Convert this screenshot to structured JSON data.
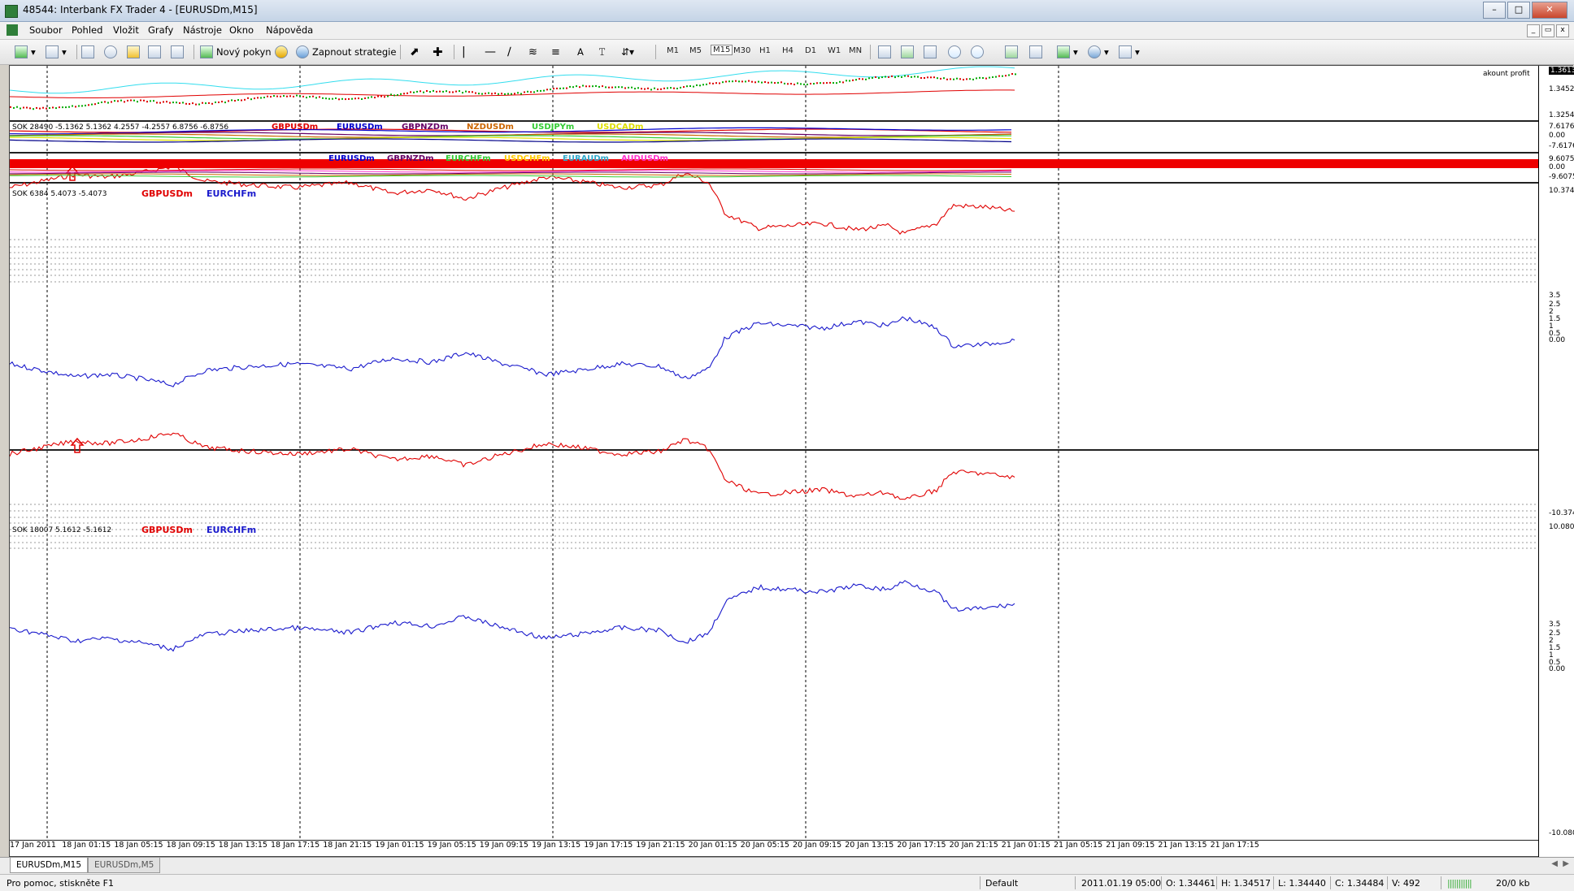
{
  "window": {
    "title": "48544: Interbank FX Trader 4 - [EURUSDm,M15]"
  },
  "menu": [
    "Soubor",
    "Pohled",
    "Vložit",
    "Grafy",
    "Nástroje",
    "Okno",
    "Nápověda"
  ],
  "toolbar": {
    "new_order": "Nový pokyn",
    "strategy": "Zapnout strategie",
    "text_tool": "A"
  },
  "timeframes": [
    "M1",
    "M5",
    "M15",
    "M30",
    "H1",
    "H4",
    "D1",
    "W1",
    "MN"
  ],
  "main_chart": {
    "corner_label": "akount profit",
    "y_labels": [
      "1.36131",
      "1.34520",
      "1.32540"
    ]
  },
  "indicator1": {
    "label": "SOK 28490 -5.1362 5.1362 4.2557 -4.2557 6.8756 -6.8756",
    "y_labels": [
      "7.6176",
      "0.00",
      "-7.6176"
    ],
    "symbols": [
      {
        "t": "GBPUSDm",
        "c": "#e00000"
      },
      {
        "t": "EURUSDm",
        "c": "#0000cc"
      },
      {
        "t": "GBPNZDm",
        "c": "#660066"
      },
      {
        "t": "NZDUSDm",
        "c": "#cc6600"
      },
      {
        "t": "USDJPYm",
        "c": "#33cc33"
      },
      {
        "t": "USDCADm",
        "c": "#dddd00"
      }
    ]
  },
  "indicator2": {
    "y_labels": [
      "9.6075",
      "0.00",
      "-9.6075"
    ],
    "symbols": [
      {
        "t": "EURUSDm",
        "c": "#0000cc"
      },
      {
        "t": "GBPNZDm",
        "c": "#660066"
      },
      {
        "t": "EURCHFm",
        "c": "#33cc33"
      },
      {
        "t": "USDCHFm",
        "c": "#ffcc00"
      },
      {
        "t": "EURAUDm",
        "c": "#33aacc"
      },
      {
        "t": "AUDUSDm",
        "c": "#ff33cc"
      }
    ]
  },
  "indicator3": {
    "label": "SOK 6384 5.4073 -5.4073",
    "sym1": "GBPUSDm",
    "sym2": "EURCHFm",
    "y_labels": [
      "10.3743",
      "3.5",
      "2.5",
      "2",
      "1.5",
      "1",
      "0.5",
      "0.00",
      "-10.3743"
    ]
  },
  "indicator4": {
    "label": "SOK 18007 5.1612 -5.1612",
    "sym1": "GBPUSDm",
    "sym2": "EURCHFm",
    "y_labels": [
      "10.0807",
      "3.5",
      "2.5",
      "2",
      "1.5",
      "1",
      "0.5",
      "0.00",
      "-10.0807"
    ]
  },
  "x_labels": [
    "17 Jan 2011",
    "18 Jan 01:15",
    "18 Jan 05:15",
    "18 Jan 09:15",
    "18 Jan 13:15",
    "18 Jan 17:15",
    "18 Jan 21:15",
    "19 Jan 01:15",
    "19 Jan 05:15",
    "19 Jan 09:15",
    "19 Jan 13:15",
    "19 Jan 17:15",
    "19 Jan 21:15",
    "20 Jan 01:15",
    "20 Jan 05:15",
    "20 Jan 09:15",
    "20 Jan 13:15",
    "20 Jan 17:15",
    "20 Jan 21:15",
    "21 Jan 01:15",
    "21 Jan 05:15",
    "21 Jan 09:15",
    "21 Jan 13:15",
    "21 Jan 17:15"
  ],
  "tabs": [
    {
      "label": "EURUSDm,M15",
      "active": true
    },
    {
      "label": "EURUSDm,M5",
      "active": false
    }
  ],
  "status": {
    "help": "Pro pomoc, stiskněte F1",
    "profile": "Default",
    "time": "2011.01.19 05:00",
    "open": "O: 1.34461",
    "high": "H: 1.34517",
    "low": "L: 1.34440",
    "close": "C: 1.34484",
    "volume": "V: 492",
    "traffic": "20/0 kb"
  },
  "colors": {
    "gbp": "#e00000",
    "eurchf": "#1a1acc",
    "green_candle": "#00aa00",
    "red_candle": "#dd0000",
    "cyan": "#33ddee"
  }
}
